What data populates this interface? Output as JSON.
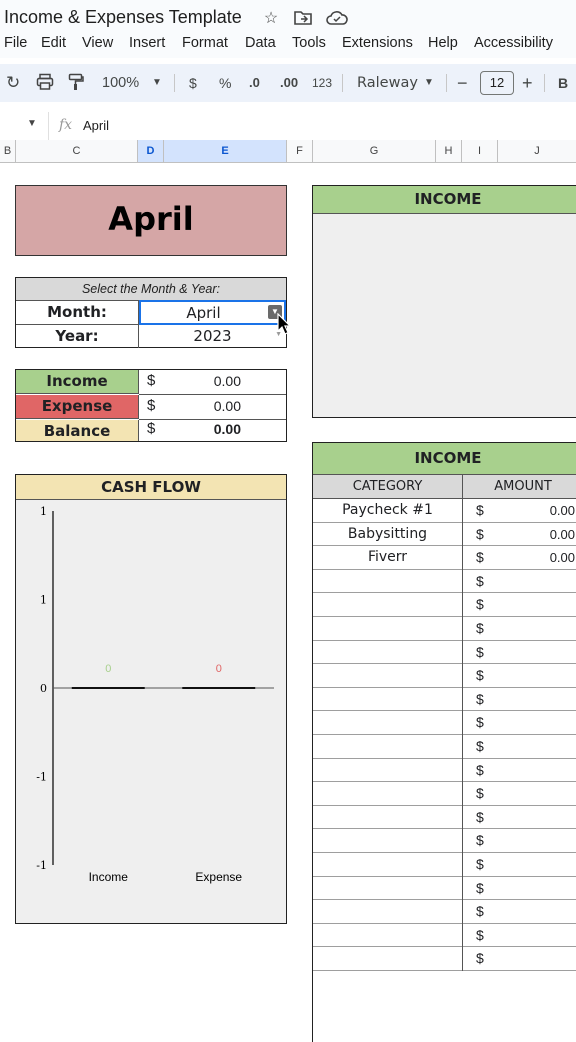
{
  "app": {
    "title": "Income & Expenses Template",
    "icons": [
      "star-icon",
      "move-to-folder-icon",
      "cloud-saved-icon"
    ]
  },
  "menu": [
    "File",
    "Edit",
    "View",
    "Insert",
    "Format",
    "Data",
    "Tools",
    "Extensions",
    "Help",
    "Accessibility"
  ],
  "toolbar": {
    "redo": "↻",
    "print": "🖶",
    "paint": "🖌",
    "zoom": "100%",
    "currency": "$",
    "percent": "%",
    "dec_decrease": ".0",
    "dec_increase": ".00",
    "number_format": "123",
    "font": "Raleway",
    "minus": "−",
    "font_size": "12",
    "plus": "+",
    "bold": "B"
  },
  "formula_bar": {
    "fx": "fx",
    "value": "April"
  },
  "columns": [
    "B",
    "C",
    "D",
    "E",
    "F",
    "G",
    "H",
    "I",
    "J"
  ],
  "sheet": {
    "month_title": "April",
    "selector": {
      "caption": "Select the Month & Year:",
      "month_label": "Month:",
      "month_value": "April",
      "year_label": "Year:",
      "year_value": "2023"
    },
    "summary": [
      {
        "label": "Income",
        "currency": "$",
        "value": "0.00",
        "color": "#a8d08d"
      },
      {
        "label": "Expense",
        "currency": "$",
        "value": "0.00",
        "color": "#e06666"
      },
      {
        "label": "Balance",
        "currency": "$",
        "value": "0.00",
        "color": "#f3e4b3"
      }
    ],
    "cash_flow": {
      "title": "CASH FLOW",
      "header_color": "#f3e4b3"
    },
    "income_chart_panel": {
      "title": "INCOME"
    },
    "income_table": {
      "title": "INCOME",
      "col_category": "CATEGORY",
      "col_amount": "AMOUNT",
      "rows": [
        {
          "category": "Paycheck #1",
          "currency": "$",
          "amount": "0.00"
        },
        {
          "category": "Babysitting",
          "currency": "$",
          "amount": "0.00"
        },
        {
          "category": "Fiverr",
          "currency": "$",
          "amount": "0.00"
        },
        {
          "category": "",
          "currency": "$",
          "amount": ""
        },
        {
          "category": "",
          "currency": "$",
          "amount": ""
        },
        {
          "category": "",
          "currency": "$",
          "amount": ""
        },
        {
          "category": "",
          "currency": "$",
          "amount": ""
        },
        {
          "category": "",
          "currency": "$",
          "amount": ""
        },
        {
          "category": "",
          "currency": "$",
          "amount": ""
        },
        {
          "category": "",
          "currency": "$",
          "amount": ""
        },
        {
          "category": "",
          "currency": "$",
          "amount": ""
        },
        {
          "category": "",
          "currency": "$",
          "amount": ""
        },
        {
          "category": "",
          "currency": "$",
          "amount": ""
        },
        {
          "category": "",
          "currency": "$",
          "amount": ""
        },
        {
          "category": "",
          "currency": "$",
          "amount": ""
        },
        {
          "category": "",
          "currency": "$",
          "amount": ""
        },
        {
          "category": "",
          "currency": "$",
          "amount": ""
        },
        {
          "category": "",
          "currency": "$",
          "amount": ""
        },
        {
          "category": "",
          "currency": "$",
          "amount": ""
        },
        {
          "category": "",
          "currency": "$",
          "amount": ""
        }
      ]
    }
  },
  "chart_data": {
    "type": "bar",
    "categories": [
      "Income",
      "Expense"
    ],
    "values": [
      0,
      0
    ],
    "data_labels": [
      "0",
      "0"
    ],
    "label_colors": [
      "#a8d08d",
      "#e06666"
    ],
    "yticks": [
      "1",
      "1",
      "0",
      "-1",
      "-1"
    ],
    "ylim": [
      -1,
      1
    ],
    "title": "",
    "xlabel": "",
    "ylabel": ""
  }
}
